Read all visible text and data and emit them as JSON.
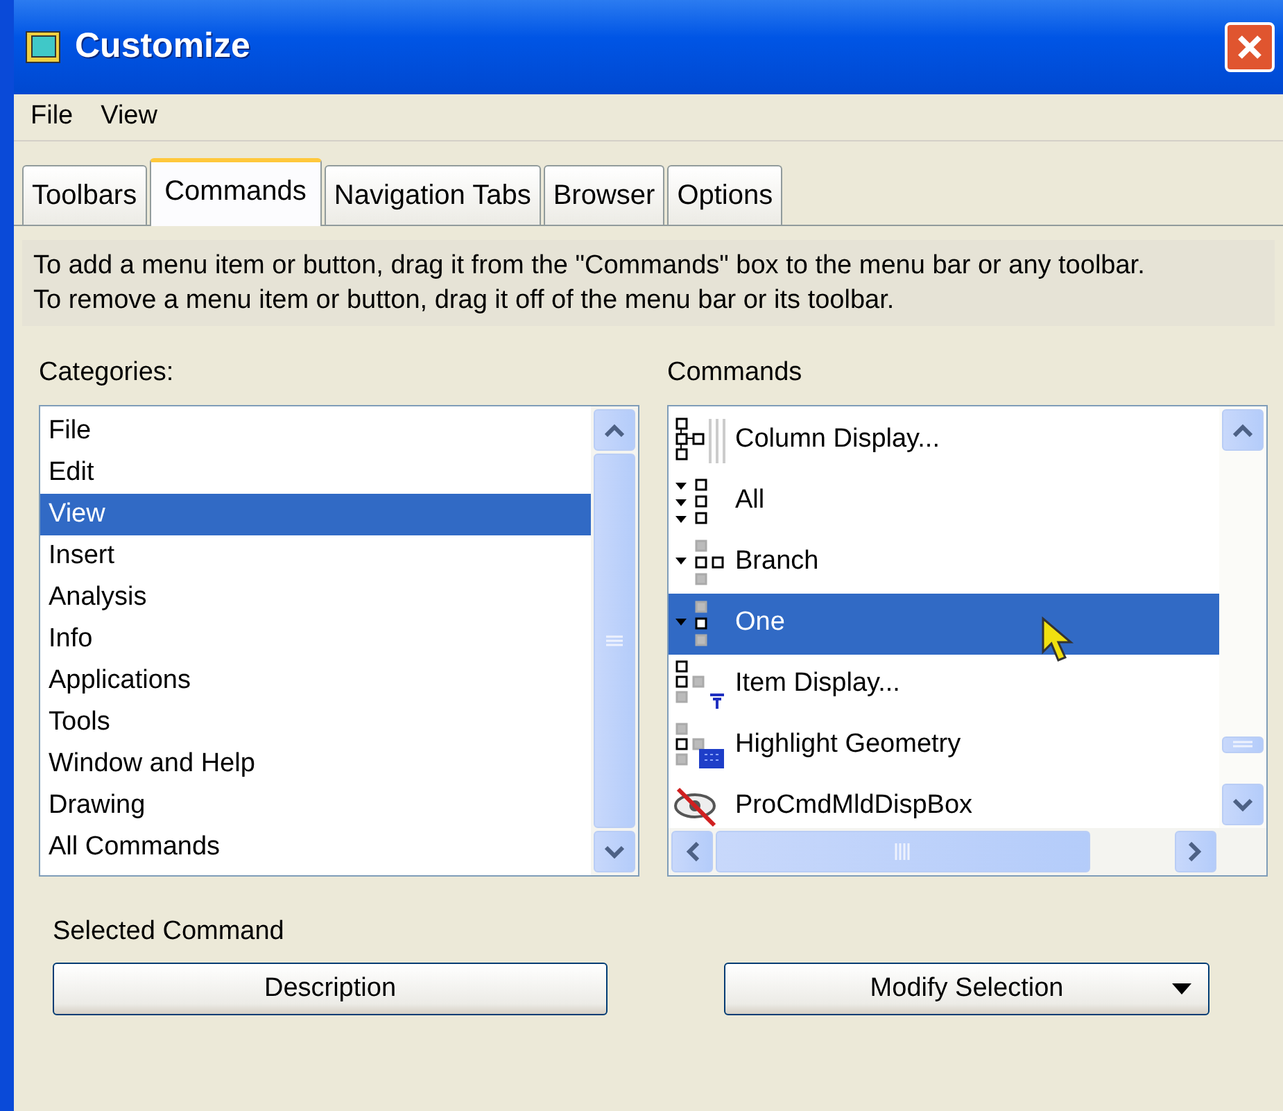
{
  "window": {
    "title": "Customize"
  },
  "menu": [
    "File",
    "View"
  ],
  "tabs": [
    {
      "label": "Toolbars",
      "selected": false
    },
    {
      "label": "Commands",
      "selected": true
    },
    {
      "label": "Navigation Tabs",
      "selected": false
    },
    {
      "label": "Browser",
      "selected": false
    },
    {
      "label": "Options",
      "selected": false
    }
  ],
  "instructions": [
    "To add a menu item or button, drag it from the \"Commands\" box to the menu bar or any toolbar.",
    "To remove a menu item or button, drag it off of the menu bar or its toolbar."
  ],
  "categories": {
    "label": "Categories:",
    "items": [
      {
        "label": "File",
        "selected": false
      },
      {
        "label": "Edit",
        "selected": false
      },
      {
        "label": "View",
        "selected": true
      },
      {
        "label": "Insert",
        "selected": false
      },
      {
        "label": "Analysis",
        "selected": false
      },
      {
        "label": "Info",
        "selected": false
      },
      {
        "label": "Applications",
        "selected": false
      },
      {
        "label": "Tools",
        "selected": false
      },
      {
        "label": "Window and Help",
        "selected": false
      },
      {
        "label": "Drawing",
        "selected": false
      },
      {
        "label": "All Commands",
        "selected": false
      }
    ]
  },
  "commands": {
    "label": "Commands",
    "items": [
      {
        "label": "Column Display...",
        "selected": false
      },
      {
        "label": "All",
        "selected": false
      },
      {
        "label": "Branch",
        "selected": false
      },
      {
        "label": "One",
        "selected": true
      },
      {
        "label": "Item Display...",
        "selected": false
      },
      {
        "label": "Highlight Geometry",
        "selected": false
      },
      {
        "label": "ProCmdMldDispBox",
        "selected": false
      }
    ]
  },
  "selected_command": {
    "label": "Selected Command",
    "buttons": [
      "Description",
      "Modify Selection"
    ]
  }
}
